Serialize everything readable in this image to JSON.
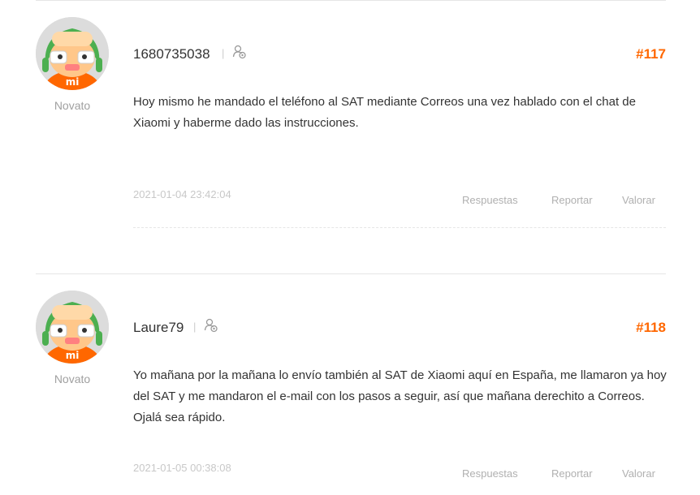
{
  "posts": [
    {
      "username": "1680735038",
      "rank": "Novato",
      "post_number": "#117",
      "body": "Hoy mismo he mandado el teléfono al SAT mediante Correos una vez hablado con el chat de Xiaomi y haberme dado las instrucciones.",
      "date": "2021-01-04 23:42:04",
      "actions": {
        "replies": "Respuestas",
        "report": "Reportar",
        "rate": "Valorar"
      }
    },
    {
      "username": "Laure79",
      "rank": "Novato",
      "post_number": "#118",
      "body": "Yo mañana por la mañana lo envío también al SAT de Xiaomi aquí en España, me llamaron ya hoy del SAT y me mandaron el e-mail con los pasos a seguir, así que mañana derechito a Correos. Ojalá sea rápido.",
      "date": "2021-01-05 00:38:08",
      "actions": {
        "replies": "Respuestas",
        "report": "Reportar",
        "rate": "Valorar"
      }
    }
  ],
  "separator": "|",
  "icons": {
    "avatar": "mi-bunny-avatar",
    "user_badge": "user-badge-icon"
  },
  "colors": {
    "accent": "#ff6700",
    "muted": "#b0b0b0",
    "text": "#333333"
  }
}
